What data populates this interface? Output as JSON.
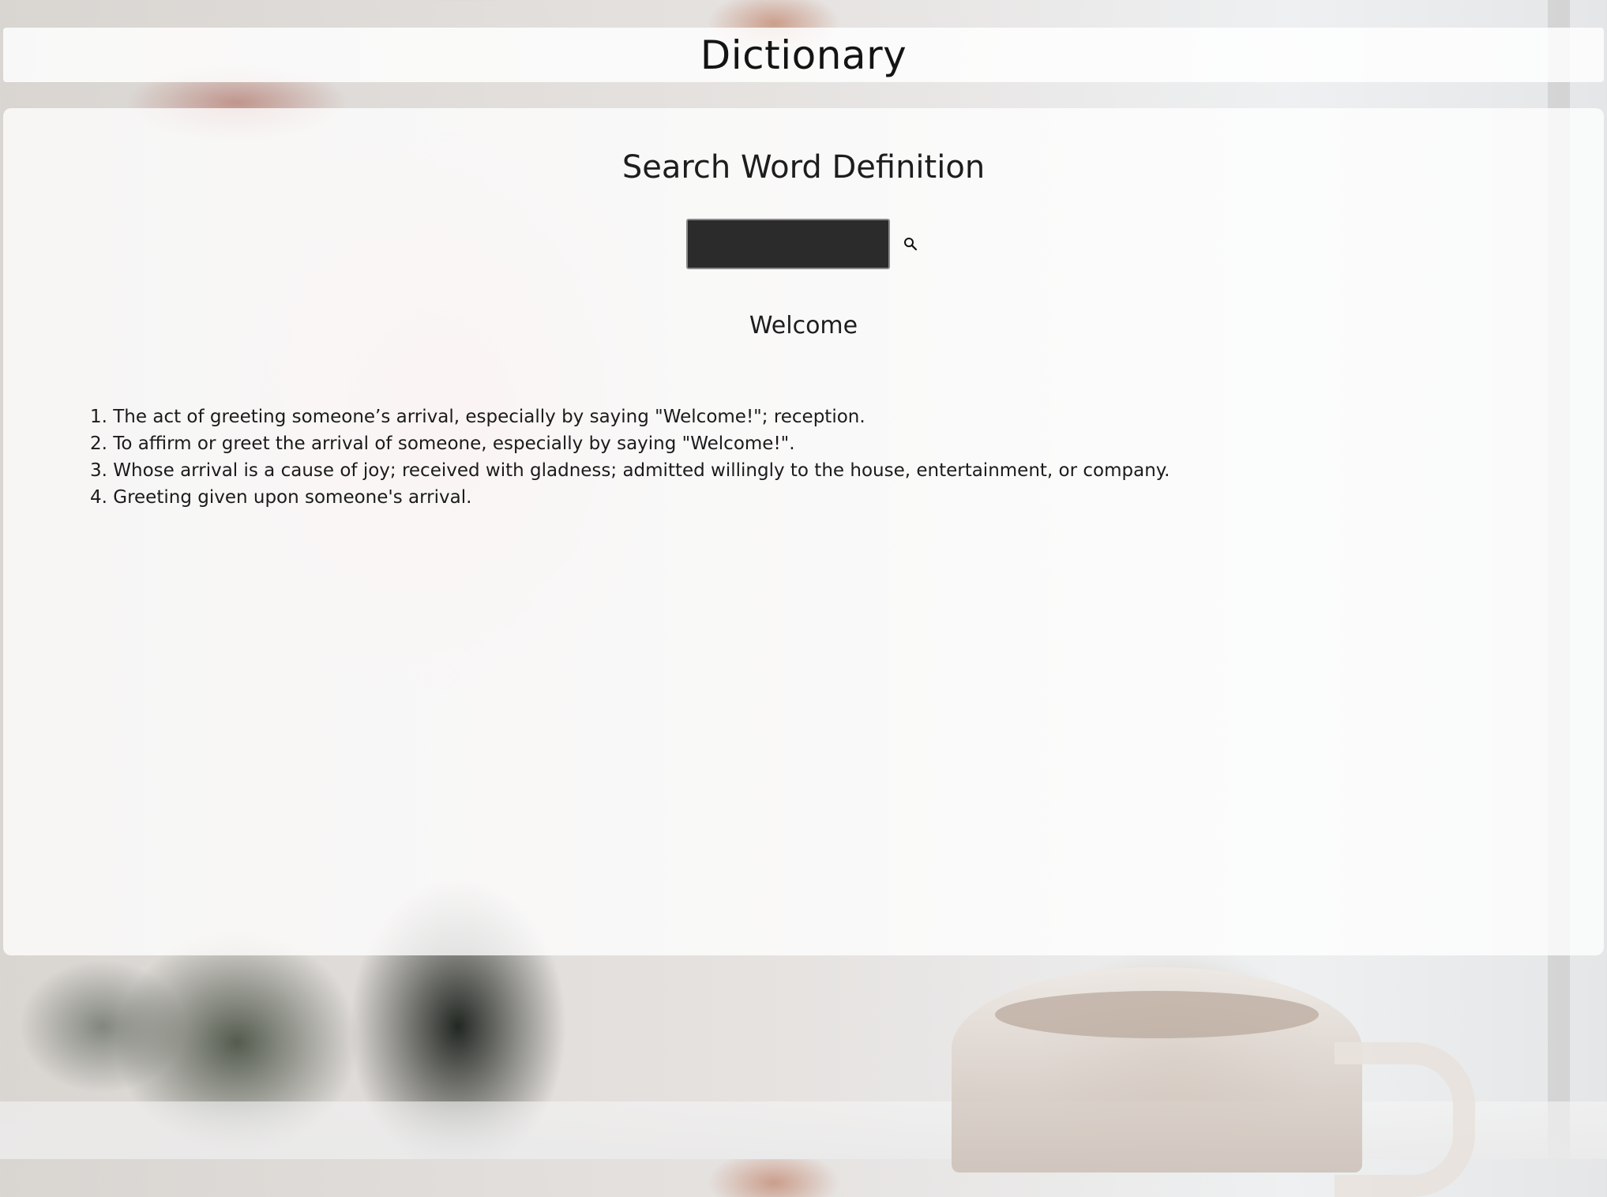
{
  "header": {
    "title": "Dictionary"
  },
  "main": {
    "heading": "Search Word Definition",
    "search": {
      "value": "",
      "placeholder": "",
      "button_icon": "search-icon"
    },
    "result": {
      "word": "Welcome",
      "definitions": [
        "1. The act of greeting someone’s arrival, especially by saying \"Welcome!\"; reception.",
        "2. To affirm or greet the arrival of someone, especially by saying \"Welcome!\".",
        "3. Whose arrival is a cause of joy; received with gladness; admitted willingly to the house, entertainment, or company.",
        "4. Greeting given upon someone's arrival."
      ]
    }
  },
  "colors": {
    "panel_background": "#ffffff",
    "search_input_background": "#2b2b2b",
    "text": "#1b1b1b"
  }
}
